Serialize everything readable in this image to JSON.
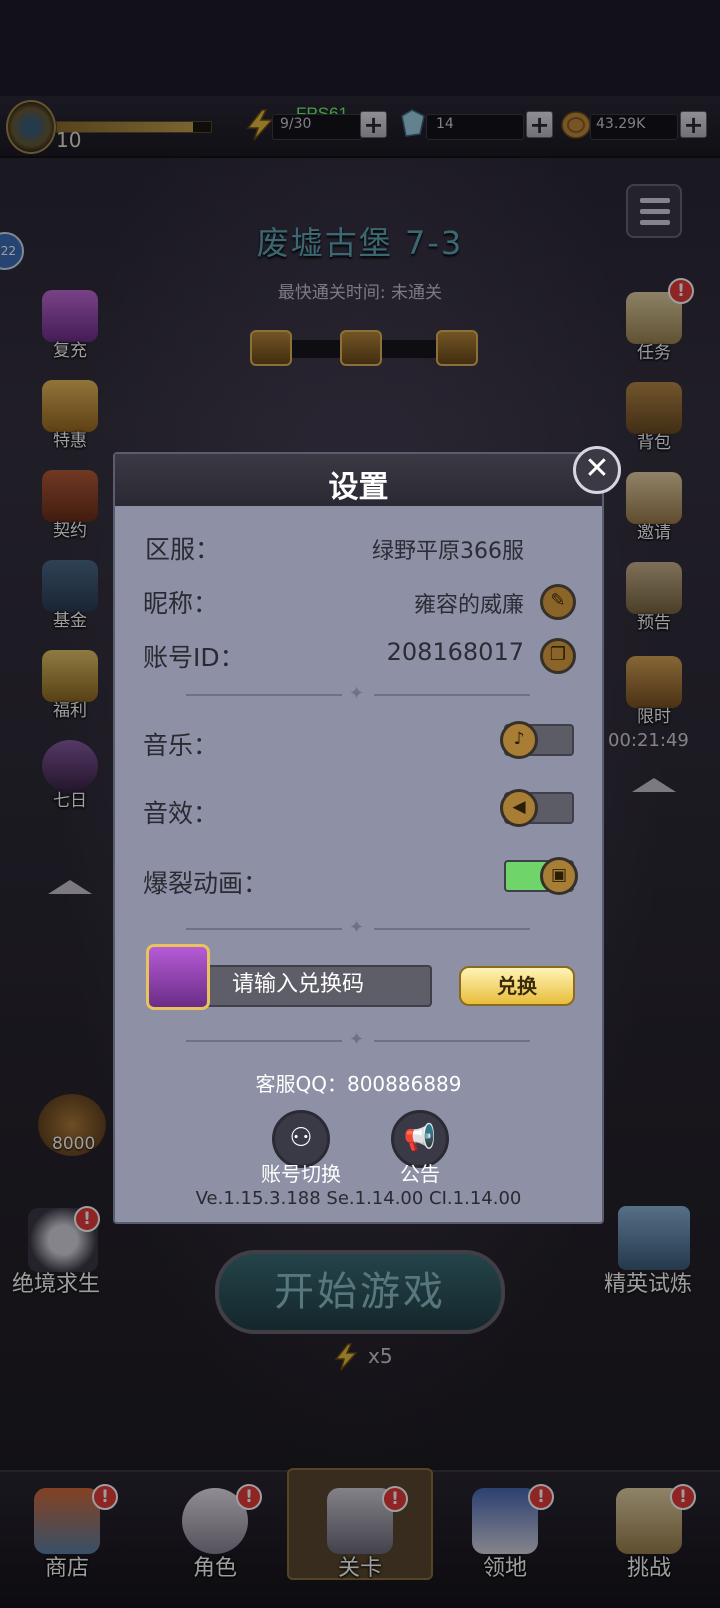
{
  "topbar": {
    "fps": "FPS61",
    "level": "10",
    "xp_fraction": 0.88,
    "energy": "9/30",
    "gems": "14",
    "gold": "43.29K"
  },
  "stage": {
    "title": "废墟古堡 7-3",
    "best_time": "最快通关时间:  未通关"
  },
  "left_side": [
    {
      "label": "复充"
    },
    {
      "label": "特惠"
    },
    {
      "label": "契约"
    },
    {
      "label": "基金"
    },
    {
      "label": "福利"
    },
    {
      "label": "七日"
    }
  ],
  "left_misc": {
    "ring_badge": "22",
    "coin_reward": "8000",
    "survival": "绝境求生"
  },
  "right_side": [
    {
      "label": "任务"
    },
    {
      "label": "背包"
    },
    {
      "label": "邀请"
    },
    {
      "label": "预告"
    },
    {
      "label": "限时"
    }
  ],
  "right_misc": {
    "timer": "00:21:49",
    "elite": "精英试炼"
  },
  "start": {
    "label": "开始游戏",
    "cost": "x5"
  },
  "bottom_nav": [
    {
      "label": "商店"
    },
    {
      "label": "角色"
    },
    {
      "label": "关卡"
    },
    {
      "label": "领地"
    },
    {
      "label": "挑战"
    }
  ],
  "settings": {
    "title": "设置",
    "server_label": "区服：",
    "server_value": "绿野平原366服",
    "nickname_label": "昵称：",
    "nickname_value": "雍容的威廉",
    "account_label": "账号ID：",
    "account_value": "208168017",
    "music_label": "音乐：",
    "music_on": false,
    "sfx_label": "音效：",
    "sfx_on": false,
    "burst_label": "爆裂动画：",
    "burst_on": true,
    "code_placeholder": "请输入兑换码",
    "redeem_label": "兑换",
    "service_qq": "客服QQ：800886889",
    "switch_account": "账号切换",
    "announcement": "公告",
    "versions": "Ve.1.15.3.188  Se.1.14.00  CI.1.14.00"
  }
}
